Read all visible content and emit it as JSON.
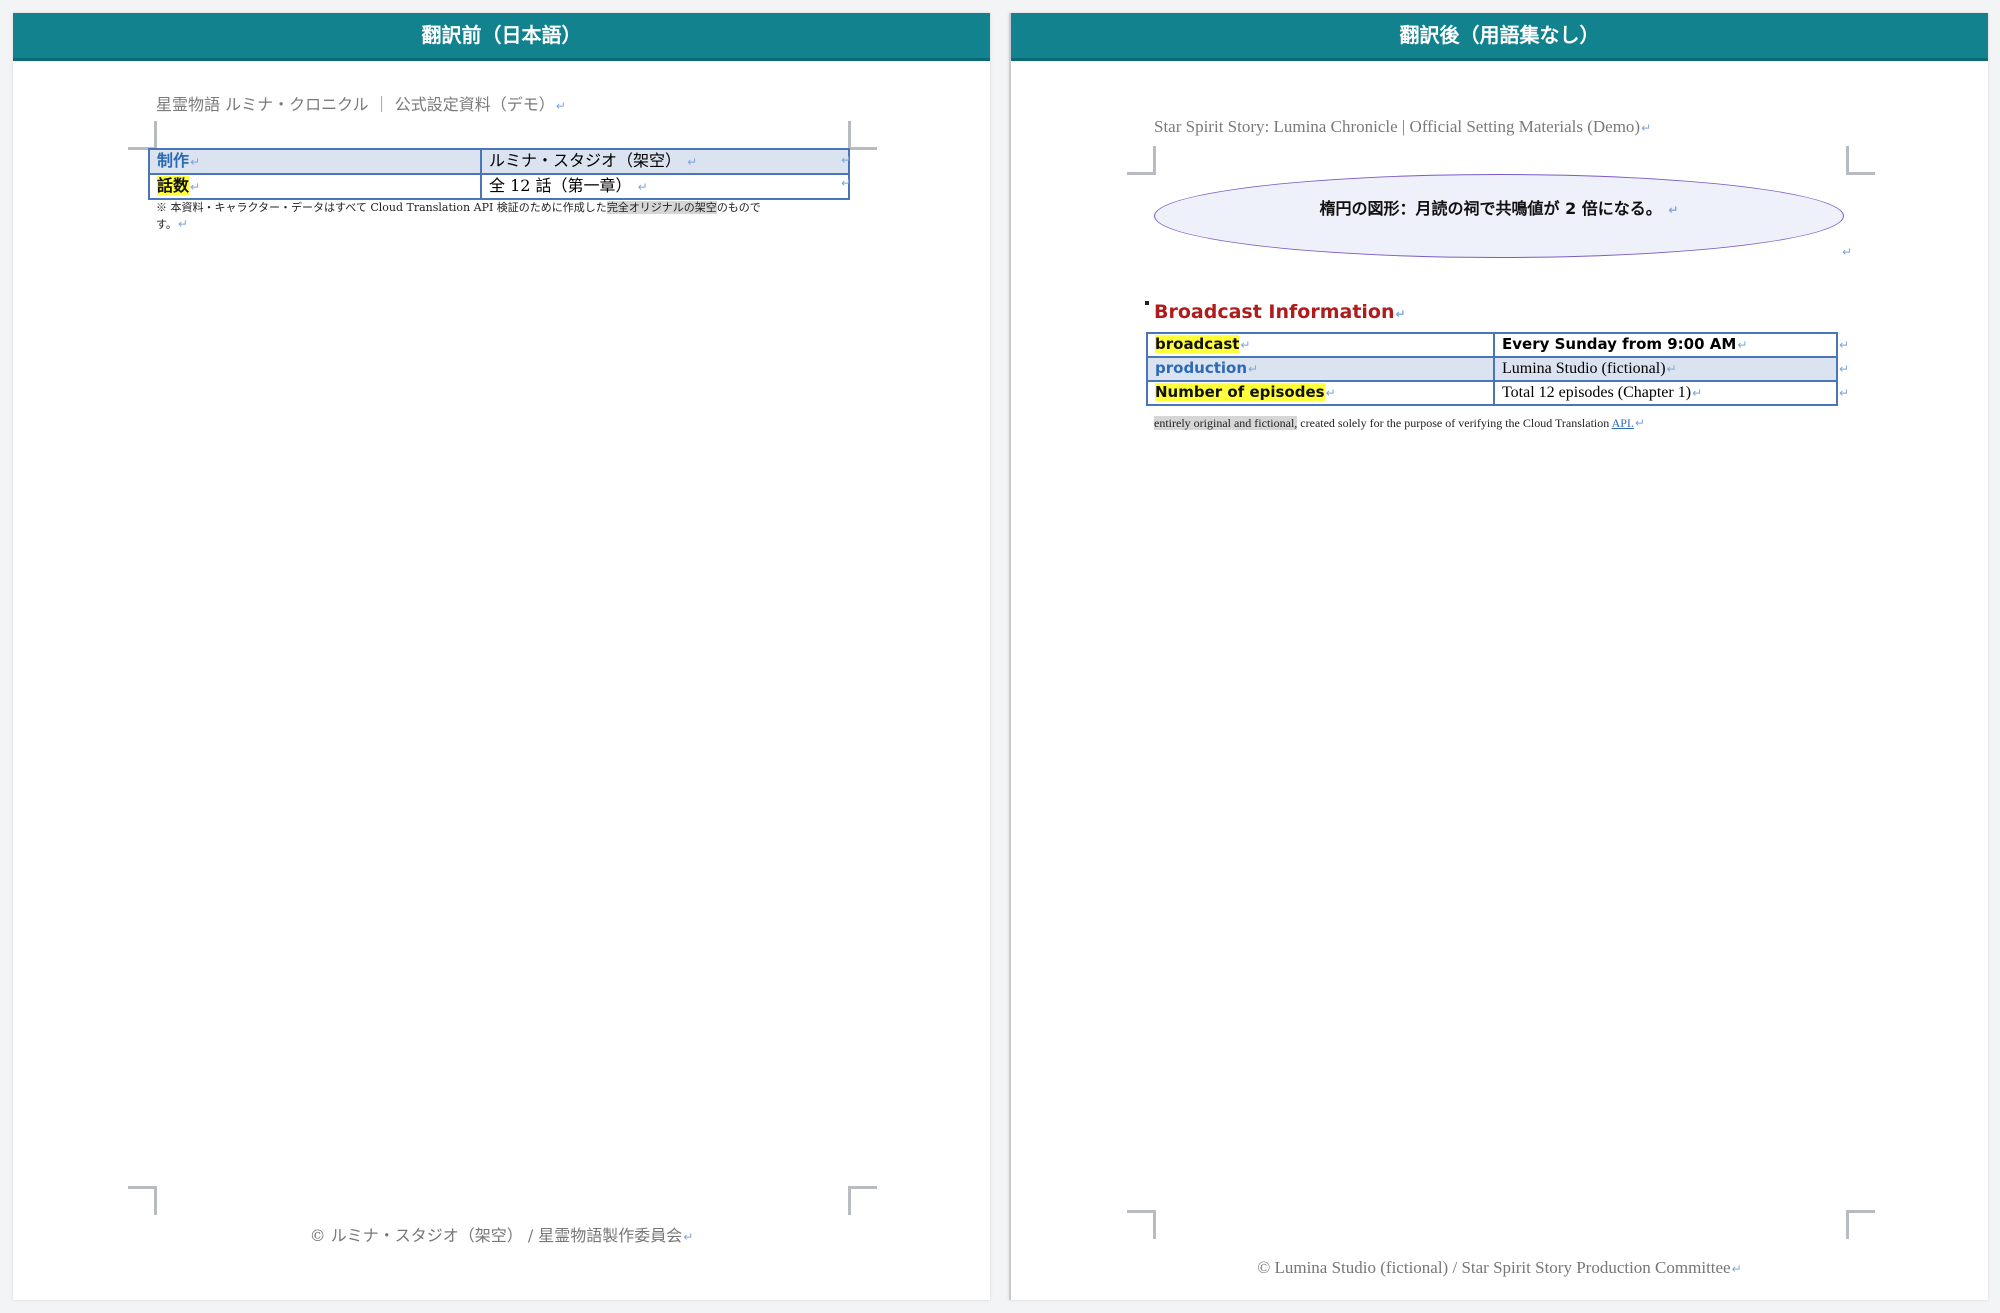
{
  "left": {
    "header_title": "翻訳前（日本語）",
    "doc_header": "星霊物語 ルミナ・クロニクル ｜ 公式設定資料（デモ）",
    "table": [
      {
        "label": "制作",
        "value": "ルミナ・スタジオ（架空）"
      },
      {
        "label": "話数",
        "value": "全 12 話（第一章）"
      }
    ],
    "note_prefix": "※ 本資料・キャラクター・データはすべて Cloud Translation API 検証のために作成した",
    "note_highlight": "完全オリジナルの架空",
    "note_suffix": "のもので",
    "note_line2": "す。",
    "footer": "© ルミナ・スタジオ（架空） / 星霊物語製作委員会"
  },
  "right": {
    "header_title": "翻訳後（用語集なし）",
    "doc_header": "Star Spirit Story: Lumina Chronicle | Official Setting Materials (Demo)",
    "ellipse_text": "楕円の図形：月読の祠で共鳴値が 2 倍になる。",
    "section_title": "Broadcast Information",
    "table": [
      {
        "label": "broadcast",
        "value": "Every Sunday from 9:00 AM"
      },
      {
        "label": "production",
        "value": "Lumina Studio (fictional)"
      },
      {
        "label": "Number of episodes",
        "value": "Total 12 episodes (Chapter 1)"
      }
    ],
    "note_highlight": "entirely original and fictional,",
    "note_rest": " created solely for the purpose of verifying the Cloud Translation ",
    "note_api": "API.",
    "footer": "© Lumina Studio (fictional) / Star Spirit Story Production Committee"
  },
  "marks": {
    "return": "↵"
  },
  "colors": {
    "header_bg": "#12828f",
    "table_border": "#4a75b8",
    "highlight": "#ffff3a",
    "section_title": "#b01c1c"
  }
}
